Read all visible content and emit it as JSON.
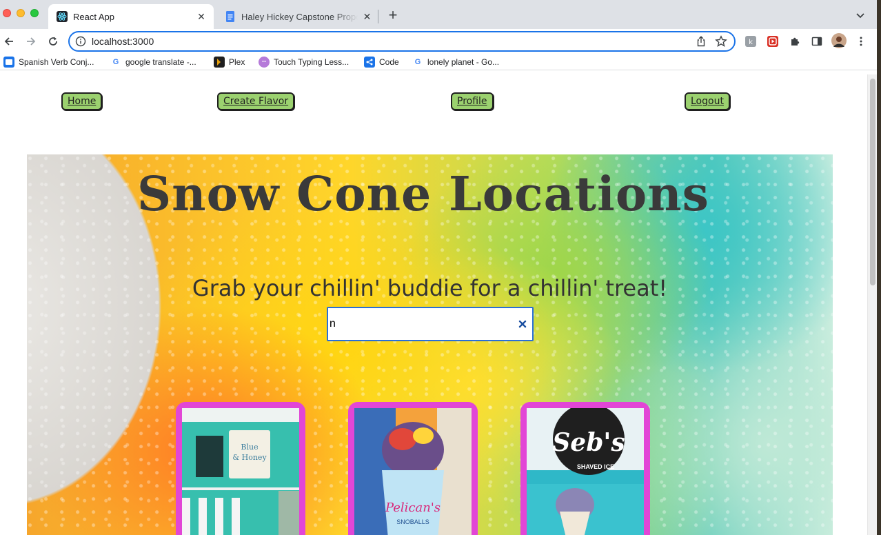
{
  "browser": {
    "tabs": [
      {
        "title": "React App",
        "active": true,
        "icon": "react-icon"
      },
      {
        "title": "Haley Hickey Capstone Propos",
        "active": false,
        "icon": "google-docs-icon"
      }
    ],
    "new_tab_label": "+",
    "url": "localhost:3000",
    "bookmarks": [
      {
        "label": "Spanish Verb Conj...",
        "icon": "spanish-verb-icon"
      },
      {
        "label": "google translate -...",
        "icon": "google-icon"
      },
      {
        "label": "Plex",
        "icon": "plex-icon"
      },
      {
        "label": "Touch Typing Less...",
        "icon": "typing-icon"
      },
      {
        "label": "Code",
        "icon": "code-icon"
      },
      {
        "label": "lonely planet - Go...",
        "icon": "google-icon"
      }
    ]
  },
  "nav": {
    "home": "Home",
    "create_flavor": "Create Flavor",
    "profile": "Profile",
    "logout": "Logout"
  },
  "hero": {
    "title": "Snow Cone Locations",
    "subtitle": "Grab your chillin' buddie for a chillin' treat!",
    "search_value": "n"
  },
  "cards": [
    {
      "image": "teal food truck photo"
    },
    {
      "image": "pelican's snoballs cup photo"
    },
    {
      "image": "seb's shaved ice photo",
      "logo_text": "Seb's",
      "logo_subtext": "SHAVED ICE"
    }
  ],
  "colors": {
    "nav_button_bg": "#9bd16f",
    "card_border": "#e246d6",
    "search_focus": "#2a6fd6",
    "title_color": "#3a3a3a"
  }
}
